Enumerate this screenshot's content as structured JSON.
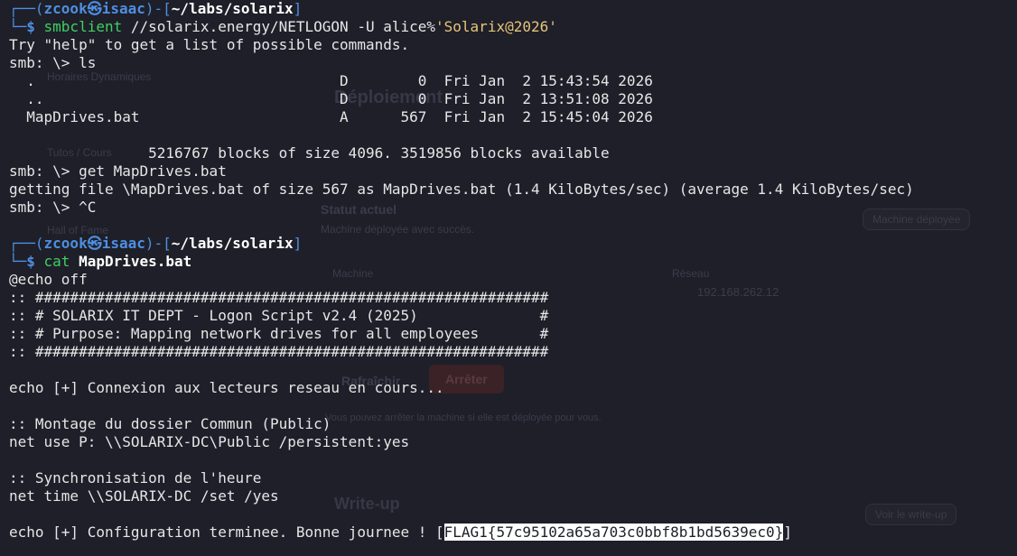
{
  "ghost_ui": {
    "horaires": "Horaires Dynamiques",
    "deploiement": "Déploiement",
    "tutos": "Tutos / Cours",
    "statut_title": "Statut actuel",
    "statut_sub": "Machine déployée avec succès.",
    "machine_badge": "Machine déployée",
    "machine_label": "Machine",
    "reseau_label": "Réseau",
    "ip": "192.168.262.12",
    "hall": "Hall of Fame",
    "refresh": "Rafraîchir",
    "stop": "Arrêter",
    "hint": "Vous pouvez arrêter la machine si elle est déployée pour vous.",
    "writeup": "Write-up",
    "voir_writeup": "Voir le write-up"
  },
  "prompt1": {
    "top_left": "┌──(",
    "user": "zcook",
    "at": "㉿",
    "host": "isaac",
    "mid": ")-[",
    "path": "~/labs/solarix",
    "end": "]",
    "bottom": "└─",
    "dollar": "$ ",
    "cmd": "smbclient",
    "args": " //solarix.energy/NETLOGON -U alice%",
    "quoted": "'Solarix@2026'"
  },
  "smb_output": [
    "Try \"help\" to get a list of possible commands.",
    "smb: \\> ls",
    "  .                                   D        0  Fri Jan  2 15:43:54 2026",
    "  ..                                  D        0  Fri Jan  2 13:51:08 2026",
    "  MapDrives.bat                       A      567  Fri Jan  2 15:45:04 2026",
    "",
    "                5216767 blocks of size 4096. 3519856 blocks available",
    "smb: \\> get MapDrives.bat",
    "getting file \\MapDrives.bat of size 567 as MapDrives.bat (1.4 KiloBytes/sec) (average 1.4 KiloBytes/sec)",
    "smb: \\> ^C",
    ""
  ],
  "prompt2": {
    "cmd": "cat",
    "args": " MapDrives.bat"
  },
  "file_lines": [
    "@echo off",
    ":: ###########################################################",
    ":: # SOLARIX IT DEPT - Logon Script v2.4 (2025)              #",
    ":: # Purpose: Mapping network drives for all employees       #",
    ":: ###########################################################",
    "",
    "echo [+] Connexion aux lecteurs reseau en cours...",
    "",
    ":: Montage du dossier Commun (Public)",
    "net use P: \\\\SOLARIX-DC\\Public /persistent:yes",
    "",
    ":: Synchronisation de l'heure",
    "net time \\\\SOLARIX-DC /set /yes",
    ""
  ],
  "last_line": {
    "prefix": "echo [+] Configuration terminee. Bonne journee ! [",
    "flag": "FLAG1{57c95102a65a703c0bbf8b1bd5639ec0}",
    "suffix": "]"
  }
}
